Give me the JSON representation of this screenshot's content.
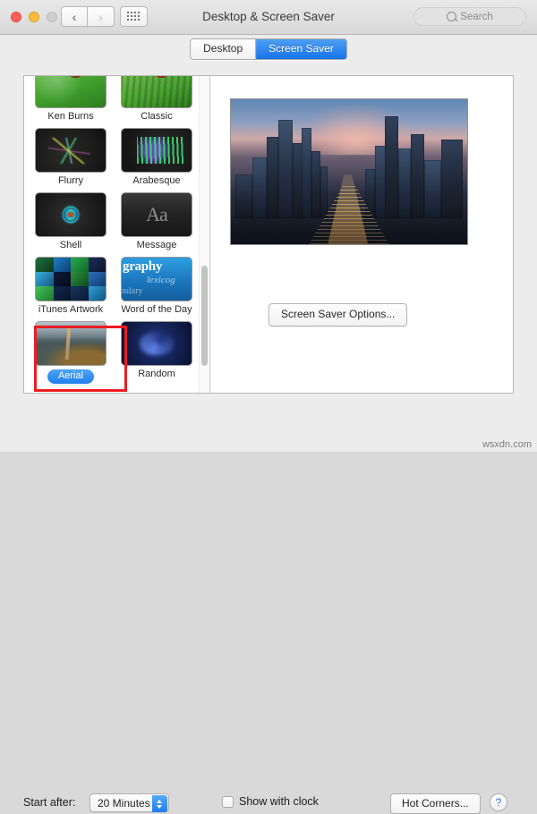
{
  "window": {
    "title": "Desktop & Screen Saver",
    "traffic_lights": [
      "close",
      "minimize",
      "zoom"
    ],
    "nav": {
      "back": "‹",
      "forward": "›",
      "grid": "grid-icon"
    },
    "search": {
      "placeholder": "Search",
      "value": "",
      "icon": "search-icon"
    }
  },
  "tabs": [
    {
      "label": "Desktop",
      "active": false
    },
    {
      "label": "Screen Saver",
      "active": true
    }
  ],
  "screensavers": [
    {
      "label": "Ken Burns",
      "art": "th-kenburns",
      "selected": false
    },
    {
      "label": "Classic",
      "art": "th-classic",
      "selected": false
    },
    {
      "label": "Flurry",
      "art": "th-flurry",
      "selected": false
    },
    {
      "label": "Arabesque",
      "art": "th-arabesque",
      "selected": false
    },
    {
      "label": "Shell",
      "art": "th-shell",
      "selected": false
    },
    {
      "label": "Message",
      "art": "th-message",
      "selected": false
    },
    {
      "label": "iTunes Artwork",
      "art": "th-itunes",
      "selected": false
    },
    {
      "label": "Word of the Day",
      "art": "th-wotd",
      "selected": false
    },
    {
      "label": "Aerial",
      "art": "th-aerial",
      "selected": true
    },
    {
      "label": "Random",
      "art": "th-random",
      "selected": false
    }
  ],
  "message_thumb_text": "Aa",
  "wotd_thumb_text": {
    "line1": "graphy",
    "line2": "lexicog",
    "line3": "bulary"
  },
  "preview": {
    "description": "city-skyline-at-dusk-preview",
    "options_button": "Screen Saver Options..."
  },
  "bottom": {
    "start_after_label": "Start after:",
    "start_after_value": "20 Minutes",
    "show_with_clock_label": "Show with clock",
    "show_with_clock_checked": false,
    "hot_corners_label": "Hot Corners...",
    "help_label": "?"
  },
  "watermark": "wsxdn.com",
  "colors": {
    "accent_blue": "#1f7cec",
    "annotation_red": "#ee1c22",
    "window_chrome": "#ececec"
  }
}
